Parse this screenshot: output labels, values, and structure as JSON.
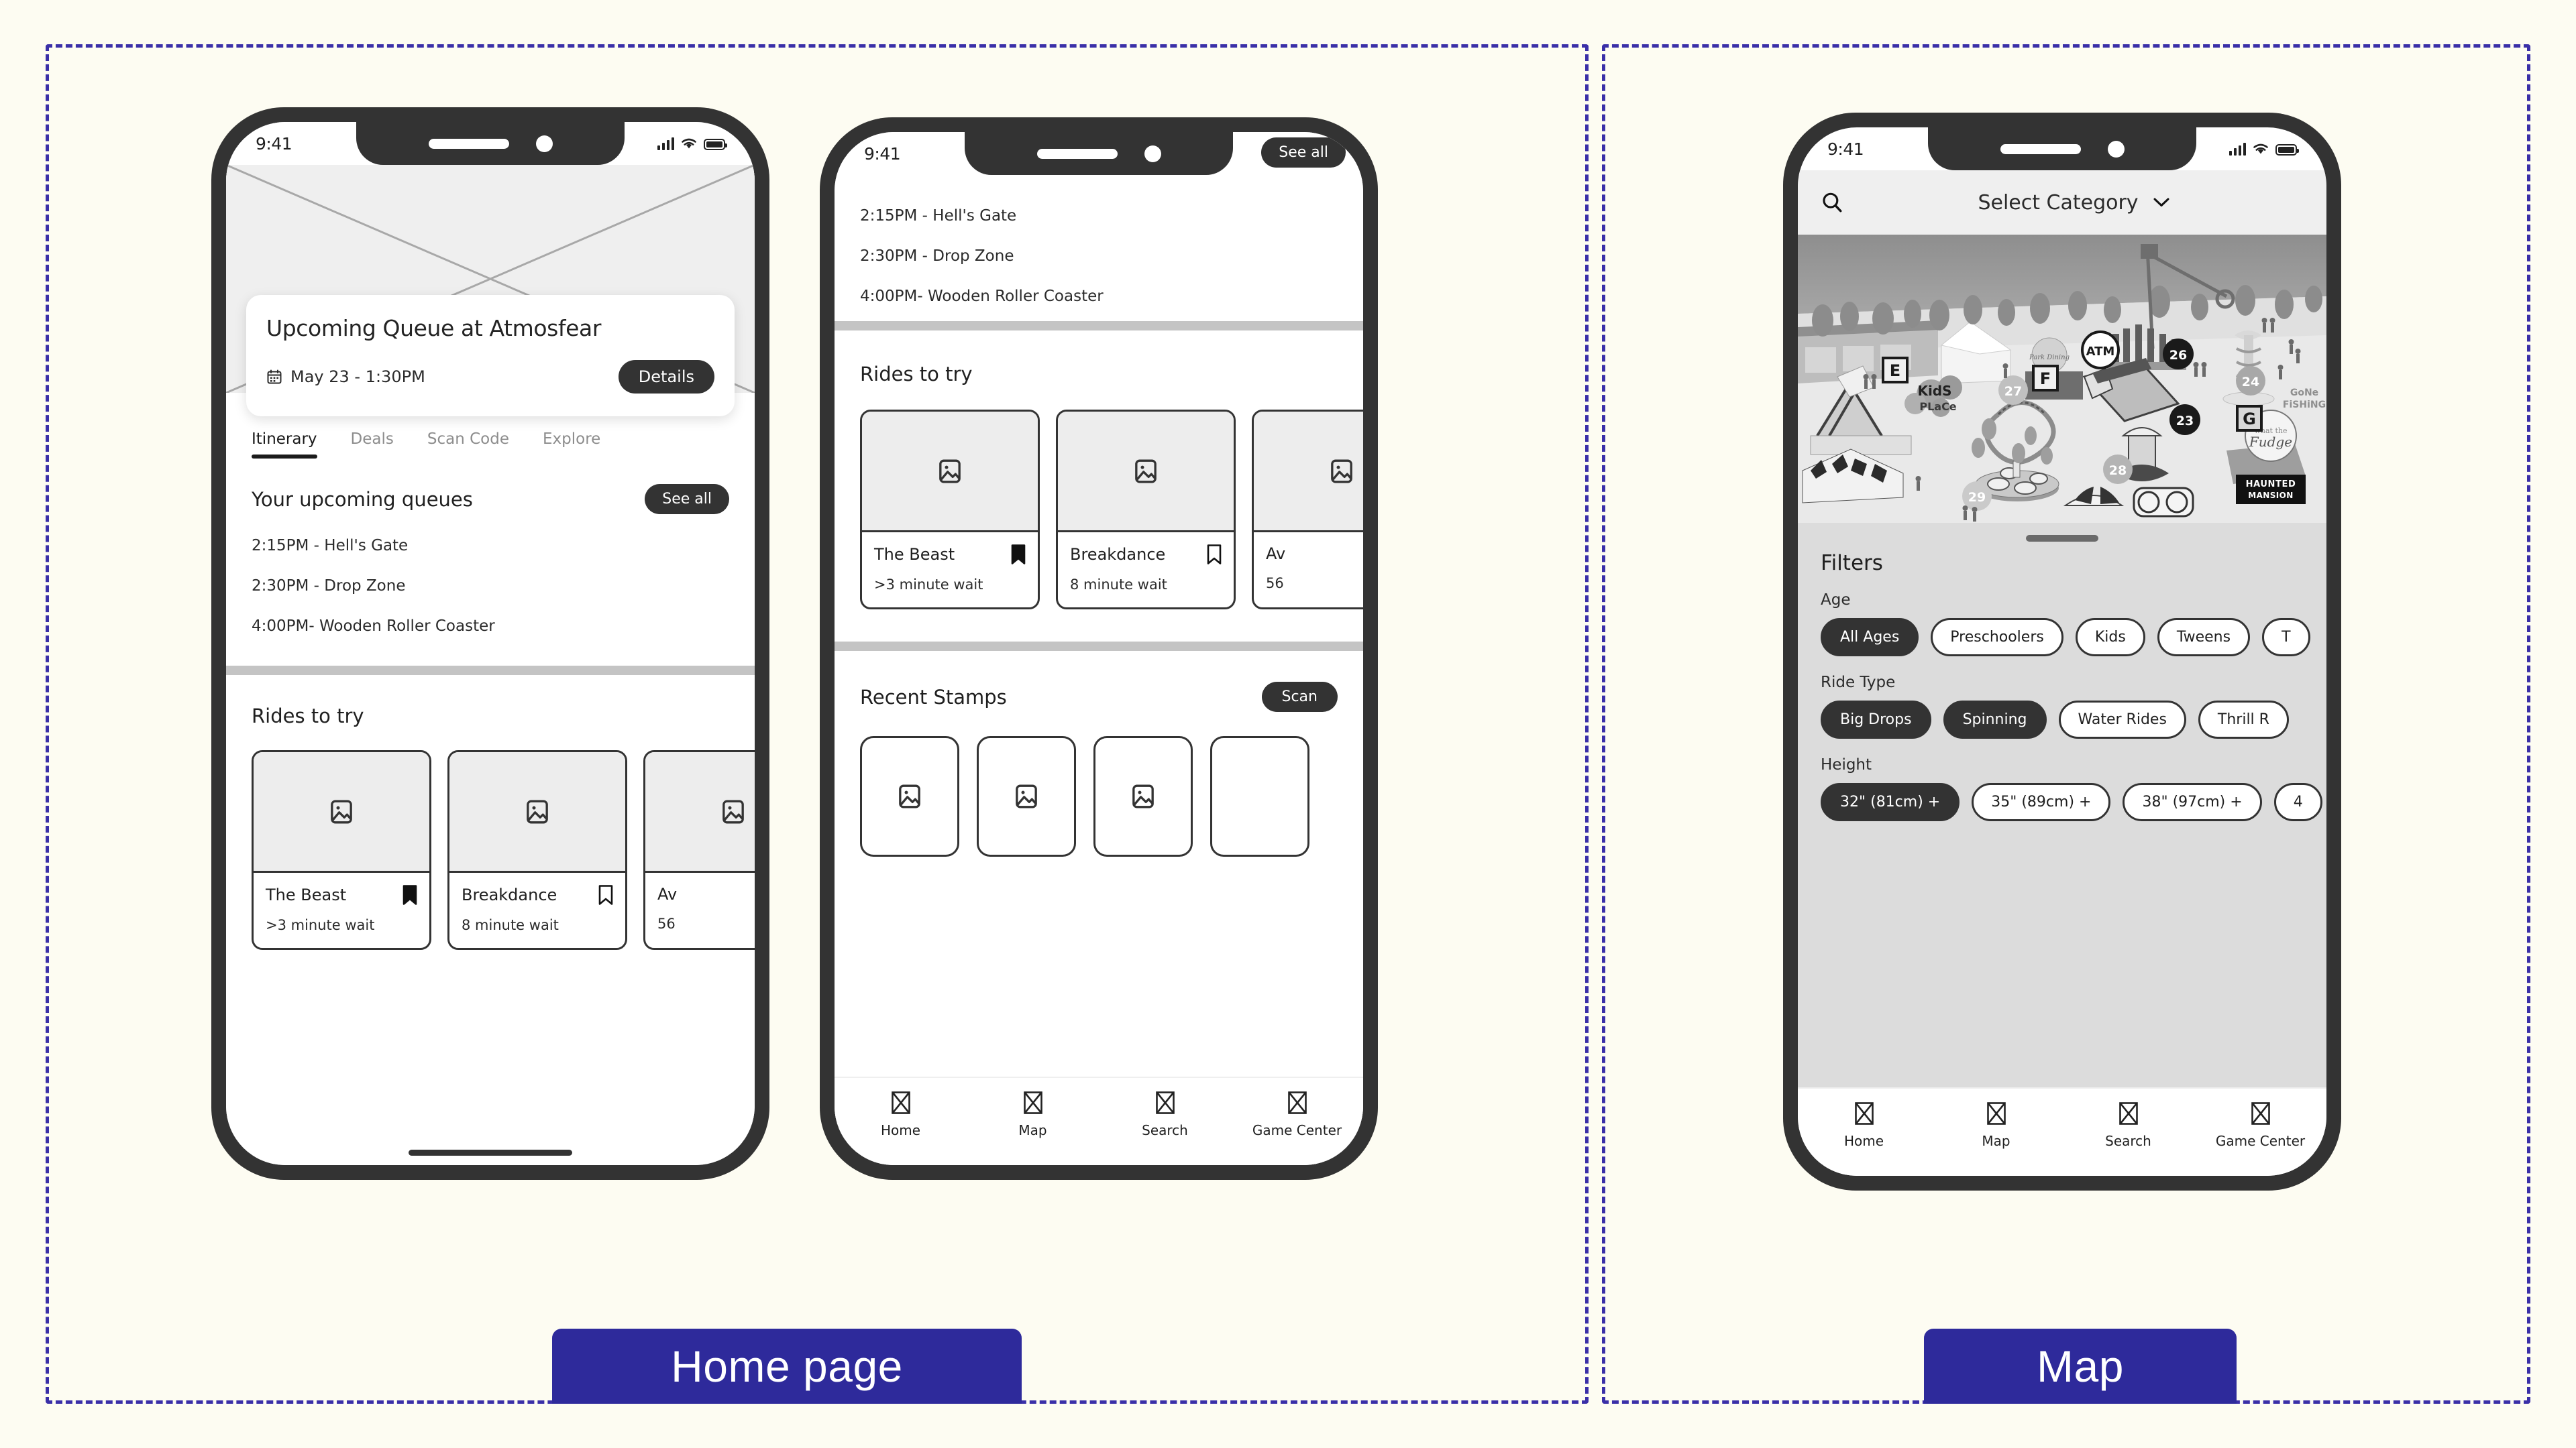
{
  "frames": {
    "home_label": "Home page",
    "map_label": "Map"
  },
  "colors": {
    "frame_border": "#3A2FA8",
    "label_bg": "#2E2A9B",
    "page_bg": "#FDFCF2",
    "accent_dark": "#333333",
    "divider": "#C4C4C4",
    "panel_bg": "#DCDCDC"
  },
  "status": {
    "time": "9:41",
    "signal_icon": "cellular-bars-icon",
    "wifi_icon": "wifi-icon",
    "battery_icon": "battery-icon"
  },
  "phone1": {
    "hero": {
      "placeholder_icon": "image-crossbox-placeholder"
    },
    "queue_card": {
      "title": "Upcoming Queue at Atmosfear",
      "calendar_icon": "calendar-icon",
      "datetime": "May 23 - 1:30PM",
      "details_label": "Details"
    },
    "tabs": [
      {
        "label": "Itinerary",
        "active": true
      },
      {
        "label": "Deals",
        "active": false
      },
      {
        "label": "Scan Code",
        "active": false
      },
      {
        "label": "Explore",
        "active": false
      }
    ],
    "queues_section": {
      "title": "Your upcoming queues",
      "see_all_label": "See all",
      "items": [
        "2:15PM - Hell's Gate",
        "2:30PM - Drop Zone",
        "4:00PM- Wooden Roller Coaster"
      ]
    },
    "rides_section": {
      "title": "Rides to try",
      "cards": [
        {
          "name": "The Beast",
          "wait": ">3 minute wait",
          "bookmark": "bookmark-filled-icon",
          "saved": true
        },
        {
          "name": "Breakdance",
          "wait": "8 minute wait",
          "bookmark": "bookmark-outline-icon",
          "saved": false
        },
        {
          "name": "Av",
          "wait": "56",
          "bookmark": "bookmark-outline-icon",
          "saved": false
        }
      ]
    }
  },
  "phone2": {
    "see_all_label": "See all",
    "queues_items": [
      "2:15PM - Hell's Gate",
      "2:30PM - Drop Zone",
      "4:00PM- Wooden Roller Coaster"
    ],
    "rides_section": {
      "title": "Rides to try",
      "cards": [
        {
          "name": "The Beast",
          "wait": ">3 minute wait",
          "bookmark": "bookmark-filled-icon",
          "saved": true
        },
        {
          "name": "Breakdance",
          "wait": "8 minute wait",
          "bookmark": "bookmark-outline-icon",
          "saved": false
        },
        {
          "name": "Av",
          "wait": "56",
          "bookmark": "bookmark-outline-icon",
          "saved": false
        }
      ]
    },
    "stamps_section": {
      "title": "Recent Stamps",
      "scan_label": "Scan",
      "count": 4
    },
    "tabbar": [
      {
        "label": "Home",
        "icon": "home-placeholder-icon"
      },
      {
        "label": "Map",
        "icon": "map-placeholder-icon"
      },
      {
        "label": "Search",
        "icon": "search-placeholder-icon"
      },
      {
        "label": "Game Center",
        "icon": "game-center-placeholder-icon"
      }
    ]
  },
  "phone3": {
    "search": {
      "search_icon": "search-icon",
      "category_label": "Select Category",
      "chevron_icon": "chevron-down-icon"
    },
    "map": {
      "atm_label": "ATM",
      "letter_markers": [
        "E",
        "F",
        "G"
      ],
      "number_markers": [
        "26",
        "27",
        "23",
        "24",
        "28",
        "29"
      ],
      "place_labels": [
        "Kids Place",
        "What the Fudge",
        "Gone Fishing",
        "HAUNTED MANSION"
      ]
    },
    "filters": {
      "title": "Filters",
      "groups": [
        {
          "label": "Age",
          "chips": [
            {
              "label": "All Ages",
              "selected": true
            },
            {
              "label": "Preschoolers",
              "selected": false
            },
            {
              "label": "Kids",
              "selected": false
            },
            {
              "label": "Tweens",
              "selected": false
            },
            {
              "label": "T",
              "selected": false
            }
          ]
        },
        {
          "label": "Ride Type",
          "chips": [
            {
              "label": "Big Drops",
              "selected": true
            },
            {
              "label": "Spinning",
              "selected": true
            },
            {
              "label": "Water Rides",
              "selected": false
            },
            {
              "label": "Thrill R",
              "selected": false
            }
          ]
        },
        {
          "label": "Height",
          "chips": [
            {
              "label": "32\" (81cm) +",
              "selected": true
            },
            {
              "label": "35\" (89cm) +",
              "selected": false
            },
            {
              "label": "38\" (97cm) +",
              "selected": false
            },
            {
              "label": "4",
              "selected": false
            }
          ]
        }
      ]
    },
    "tabbar": [
      {
        "label": "Home",
        "icon": "home-placeholder-icon"
      },
      {
        "label": "Map",
        "icon": "map-placeholder-icon"
      },
      {
        "label": "Search",
        "icon": "search-placeholder-icon"
      },
      {
        "label": "Game Center",
        "icon": "game-center-placeholder-icon"
      }
    ]
  }
}
